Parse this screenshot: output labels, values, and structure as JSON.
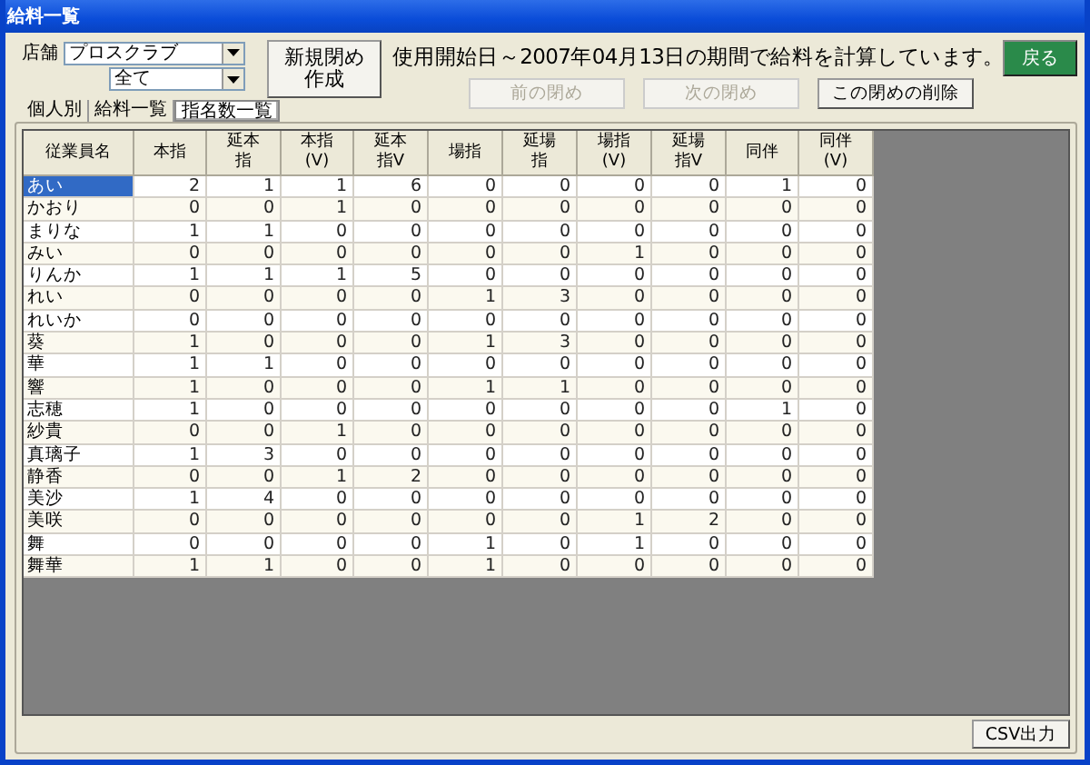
{
  "window": {
    "title": "給料一覧"
  },
  "store": {
    "label": "店舗",
    "value": "プロスクラブ"
  },
  "filter": {
    "value": "全て"
  },
  "create_button": "新規閉め作成",
  "message": "使用開始日～2007年04月13日の期間で給料を計算しています。",
  "nav_buttons": [
    {
      "label": "前の閉め",
      "disabled": true
    },
    {
      "label": "次の閉め",
      "disabled": true
    },
    {
      "label": "この閉めの削除",
      "disabled": false
    }
  ],
  "back_button": "戻る",
  "tabs": [
    {
      "label": "個人別",
      "selected": false
    },
    {
      "label": "給料一覧",
      "selected": false
    },
    {
      "label": "指名数一覧",
      "selected": true
    }
  ],
  "table": {
    "columns": [
      "従業員名",
      "本指",
      "延本指",
      "本指(V)",
      "延本指V",
      "場指",
      "延場指",
      "場指(V)",
      "延場指V",
      "同伴",
      "同伴(V)"
    ],
    "rows": [
      {
        "selected": true,
        "cells": [
          "あい",
          "2",
          "1",
          "1",
          "6",
          "0",
          "0",
          "0",
          "0",
          "1",
          "0"
        ]
      },
      {
        "selected": false,
        "cells": [
          "かおり",
          "0",
          "0",
          "1",
          "0",
          "0",
          "0",
          "0",
          "0",
          "0",
          "0"
        ]
      },
      {
        "selected": false,
        "cells": [
          "まりな",
          "1",
          "1",
          "0",
          "0",
          "0",
          "0",
          "0",
          "0",
          "0",
          "0"
        ]
      },
      {
        "selected": false,
        "cells": [
          "みい",
          "0",
          "0",
          "0",
          "0",
          "0",
          "0",
          "1",
          "0",
          "0",
          "0"
        ]
      },
      {
        "selected": false,
        "cells": [
          "りんか",
          "1",
          "1",
          "1",
          "5",
          "0",
          "0",
          "0",
          "0",
          "0",
          "0"
        ]
      },
      {
        "selected": false,
        "cells": [
          "れい",
          "0",
          "0",
          "0",
          "0",
          "1",
          "3",
          "0",
          "0",
          "0",
          "0"
        ]
      },
      {
        "selected": false,
        "cells": [
          "れいか",
          "0",
          "0",
          "0",
          "0",
          "0",
          "0",
          "0",
          "0",
          "0",
          "0"
        ]
      },
      {
        "selected": false,
        "cells": [
          "葵",
          "1",
          "0",
          "0",
          "0",
          "1",
          "3",
          "0",
          "0",
          "0",
          "0"
        ]
      },
      {
        "selected": false,
        "cells": [
          "華",
          "1",
          "1",
          "0",
          "0",
          "0",
          "0",
          "0",
          "0",
          "0",
          "0"
        ]
      },
      {
        "selected": false,
        "cells": [
          "響",
          "1",
          "0",
          "0",
          "0",
          "1",
          "1",
          "0",
          "0",
          "0",
          "0"
        ]
      },
      {
        "selected": false,
        "cells": [
          "志穂",
          "1",
          "0",
          "0",
          "0",
          "0",
          "0",
          "0",
          "0",
          "1",
          "0"
        ]
      },
      {
        "selected": false,
        "cells": [
          "紗貴",
          "0",
          "0",
          "1",
          "0",
          "0",
          "0",
          "0",
          "0",
          "0",
          "0"
        ]
      },
      {
        "selected": false,
        "cells": [
          "真璃子",
          "1",
          "3",
          "0",
          "0",
          "0",
          "0",
          "0",
          "0",
          "0",
          "0"
        ]
      },
      {
        "selected": false,
        "cells": [
          "静香",
          "0",
          "0",
          "1",
          "2",
          "0",
          "0",
          "0",
          "0",
          "0",
          "0"
        ]
      },
      {
        "selected": false,
        "cells": [
          "美沙",
          "1",
          "4",
          "0",
          "0",
          "0",
          "0",
          "0",
          "0",
          "0",
          "0"
        ]
      },
      {
        "selected": false,
        "cells": [
          "美咲",
          "0",
          "0",
          "0",
          "0",
          "0",
          "0",
          "1",
          "2",
          "0",
          "0"
        ]
      },
      {
        "selected": false,
        "cells": [
          "舞",
          "0",
          "0",
          "0",
          "0",
          "1",
          "0",
          "1",
          "0",
          "0",
          "0"
        ]
      },
      {
        "selected": false,
        "cells": [
          "舞華",
          "1",
          "1",
          "0",
          "0",
          "1",
          "0",
          "0",
          "0",
          "0",
          "0"
        ]
      }
    ]
  },
  "csv_button": "CSV出力"
}
